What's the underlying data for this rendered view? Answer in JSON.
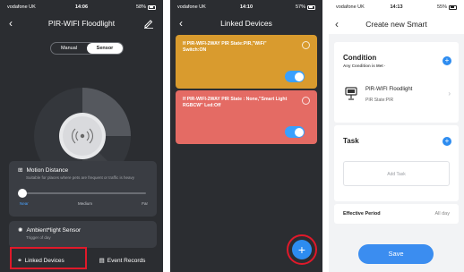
{
  "screen1": {
    "status": {
      "carrier": "vodafone UK",
      "time": "14:06",
      "battery": "58%"
    },
    "title": "PIR-WIFI Floodlight",
    "segment": {
      "manual": "Manual",
      "sensor": "Sensor",
      "selected": "Sensor"
    },
    "motion": {
      "title": "Motion Distance",
      "description": "Suitable for places where pets are frequent or traffic is heavy",
      "labels": [
        "Near",
        "Medium",
        "Far"
      ],
      "level": "Near"
    },
    "ambient": {
      "title": "Ambient*light Sensor",
      "description": "Trigger of day"
    },
    "bottom": {
      "linked": "Linked Devices",
      "records": "Event Records"
    }
  },
  "screen2": {
    "status": {
      "carrier": "vodafone UK",
      "time": "14:10",
      "battery": "57%"
    },
    "title": "Linked Devices",
    "rules": [
      {
        "text": "If PIR-WIFI-2WAY PIR State:PIR,\"WiFi\" Switch:ON",
        "enabled": true,
        "color": "#d99b2e"
      },
      {
        "text": "If PIR-WIFI-2WAY PIR State : None,\"Smart Light RGBCW\" Led:Off",
        "enabled": true,
        "color": "#e46b64"
      }
    ],
    "fab_label": "+"
  },
  "screen3": {
    "status": {
      "carrier": "vodafone UK",
      "time": "14:13",
      "battery": "55%"
    },
    "title": "Create new Smart",
    "condition": {
      "title": "Condition",
      "subtitle": "Any Condition is Met ·",
      "device_name": "PIR-WIFI Floodlight",
      "device_state": "PIR State:PIR"
    },
    "task": {
      "title": "Task",
      "placeholder": "Add Task"
    },
    "effective": {
      "label": "Effective Period",
      "value": "All day"
    },
    "save": "Save"
  },
  "colors": {
    "accent": "#2d8cf0",
    "highlight": "#e0192a",
    "dark_bg": "#2b2d31"
  }
}
